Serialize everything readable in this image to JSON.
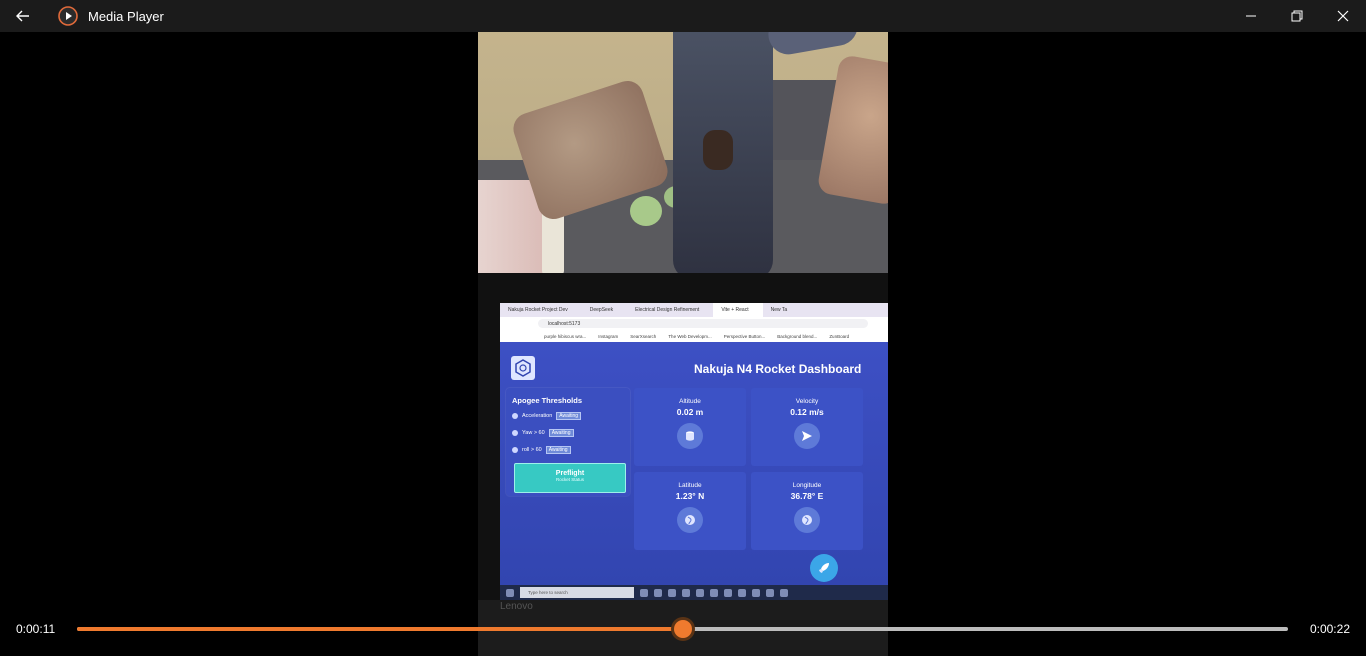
{
  "titlebar": {
    "app_title": "Media Player"
  },
  "laptop": {
    "tabs": [
      "Nakuja Rocket Project Dev",
      "DeepSeek",
      "Electrical Design Refinement",
      "Vite + React",
      "New Ta"
    ],
    "url": "localhost:5173",
    "bookmarks": [
      "purple hibiscus wra...",
      "Instagram",
      "SearXsearch",
      "The Web Developm...",
      "Perspective Button...",
      "Background blend...",
      "ZunBoard"
    ],
    "base_text": "Lenovo"
  },
  "dashboard": {
    "title": "Nakuja N4 Rocket Dashboard",
    "apogee": {
      "title": "Apogee Thresholds",
      "rows": [
        {
          "label": "Acceleration",
          "status": "Awaiting"
        },
        {
          "label": "Yaw > 60",
          "status": "Awaiting"
        },
        {
          "label": "roll > 60",
          "status": "Awaiting"
        }
      ],
      "status_title": "Preflight",
      "status_sub": "Rocket Status"
    },
    "cards": [
      {
        "label": "Altitude",
        "value": "0.02 m",
        "icon": "database-icon"
      },
      {
        "label": "Velocity",
        "value": "0.12 m/s",
        "icon": "send-icon"
      },
      {
        "label": "Latitude",
        "value": "1.23° N",
        "icon": "globe-icon"
      },
      {
        "label": "Longitude",
        "value": "36.78° E",
        "icon": "globe-icon"
      }
    ],
    "taskbar_search": "Type here to search"
  },
  "playback": {
    "current_time": "0:00:11",
    "total_time": "0:00:22",
    "progress": 0.5,
    "accent_color": "#ef7a2e"
  }
}
